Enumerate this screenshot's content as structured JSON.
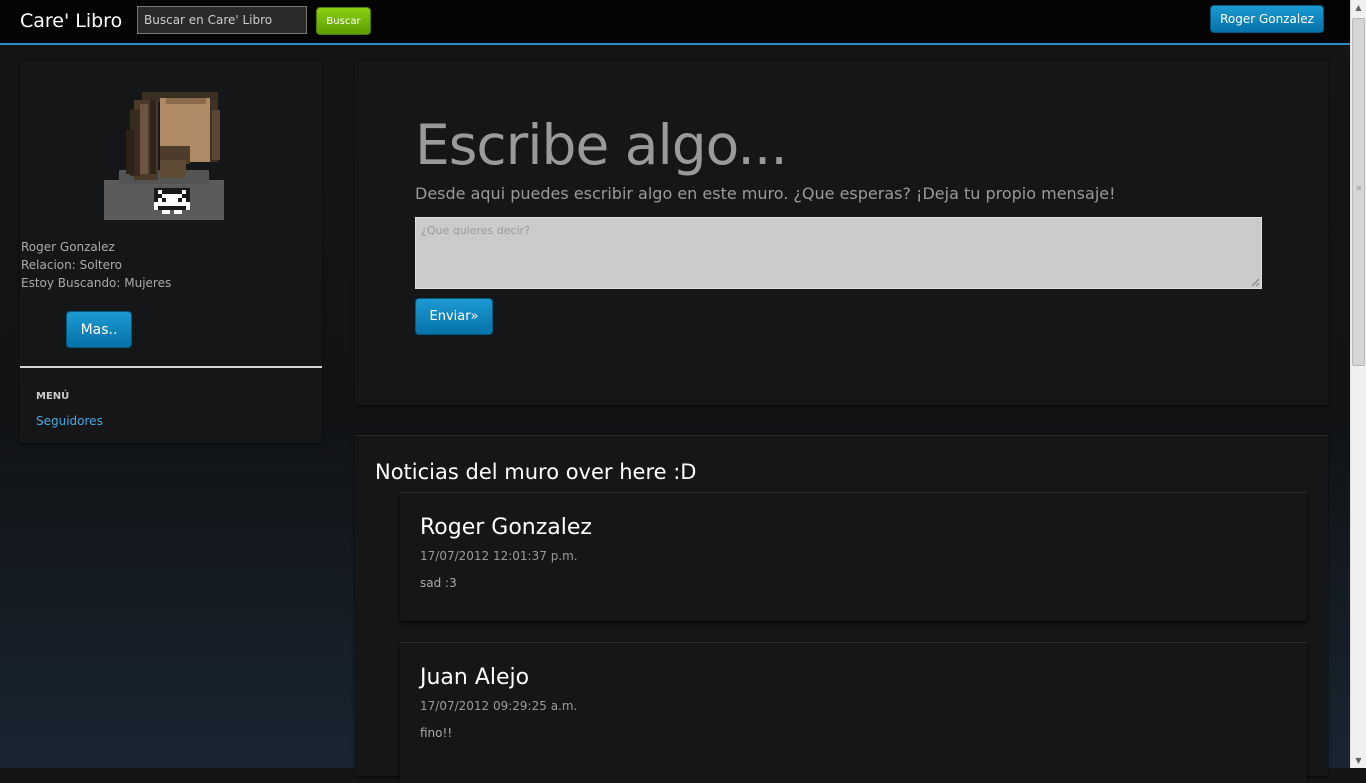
{
  "navbar": {
    "brand": "Care' Libro",
    "search_placeholder": "Buscar en Care' Libro",
    "search_button": "Buscar",
    "user_button": "Roger Gonzalez"
  },
  "sidebar": {
    "profile": {
      "name": "Roger Gonzalez",
      "relation": "Relacion: Soltero",
      "looking_for": "Estoy Buscando: Mujeres"
    },
    "more_button": "Mas..",
    "menu_header": "MENÚ",
    "menu_items": [
      {
        "label": "Seguidores"
      }
    ]
  },
  "composer": {
    "title": "Escribe algo...",
    "subtitle": "Desde aqui puedes escribir algo en este muro. ¿Que esperas? ¡Deja tu propio mensaje!",
    "placeholder": "¿Que quieres decir?",
    "send_button": "Enviar»"
  },
  "feed": {
    "title": "Noticias del muro over here :D",
    "posts": [
      {
        "author": "Roger Gonzalez",
        "date": "17/07/2012 12:01:37 p.m.",
        "text": "sad :3"
      },
      {
        "author": "Juan Alejo",
        "date": "17/07/2012 09:29:25 a.m.",
        "text": "fino!!"
      }
    ]
  },
  "colors": {
    "accent_blue": "#0e86c2",
    "search_green": "#6bb207",
    "link_blue": "#49a9e2",
    "navbar_border": "#2f8bc4"
  },
  "icons": {
    "avatar": "pixel-art-avatar-icon",
    "scroll_up": "scroll-up-arrow-icon",
    "scroll_down": "scroll-down-arrow-icon"
  }
}
